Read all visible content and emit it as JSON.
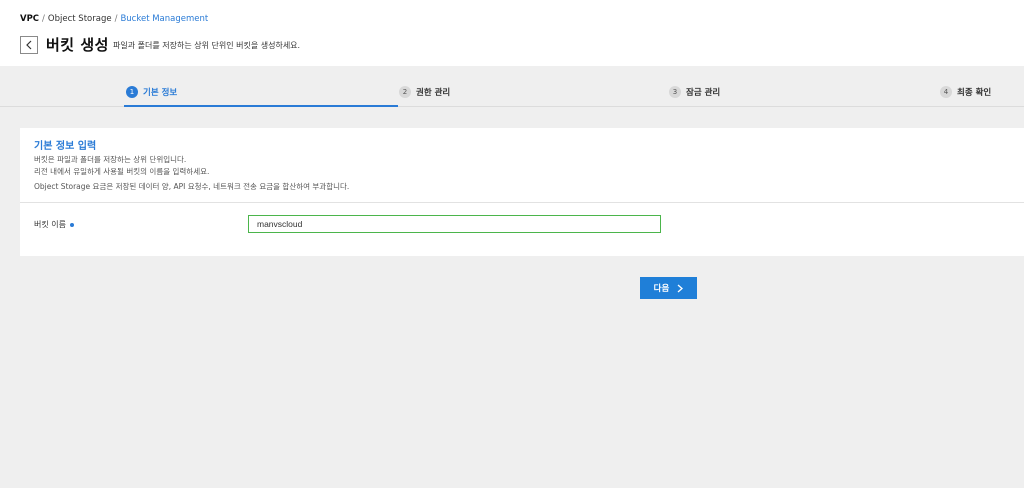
{
  "breadcrumb": [
    {
      "label": "VPC"
    },
    {
      "label": "Object Storage"
    },
    {
      "label": "Bucket Management"
    }
  ],
  "breadcrumb_sep": "/",
  "header": {
    "title": "버킷 생성",
    "description": "파일과 폴더를 저장하는 상위 단위인 버킷을 생성하세요."
  },
  "steps": [
    {
      "num": "1",
      "label": "기본 정보",
      "active": true
    },
    {
      "num": "2",
      "label": "권한 관리",
      "active": false
    },
    {
      "num": "3",
      "label": "잠금 관리",
      "active": false
    },
    {
      "num": "4",
      "label": "최종 확인",
      "active": false
    }
  ],
  "section": {
    "title": "기본 정보 입력",
    "desc1": "버킷은 파일과 폴더를 저장하는 상위 단위입니다.",
    "desc2": "리전 내에서 유일하게 사용될 버킷의 이름을 입력하세요.",
    "desc3": "Object Storage 요금은 저장된 데이터 양, API 요청수, 네트워크 전송 요금을 합산하여 부과합니다."
  },
  "form": {
    "bucket_name_label": "버킷 이름",
    "bucket_name_value": "manvscloud"
  },
  "next_button": {
    "label": "다음"
  },
  "colors": {
    "accent": "#2a7bd6",
    "input_border": "#4bb54b",
    "background": "#efefef"
  }
}
